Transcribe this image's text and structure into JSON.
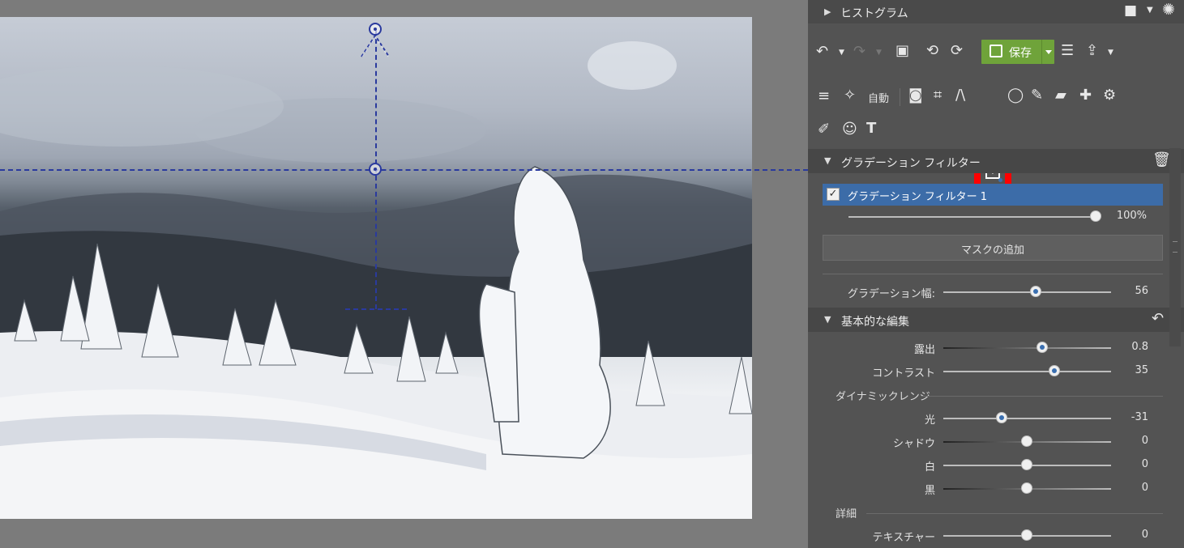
{
  "histogram": {
    "title": "ヒストグラム"
  },
  "toolbar": {
    "save_label": "保存",
    "auto_label": "自動"
  },
  "gradient_filter": {
    "section_title": "グラデーション フィルター",
    "layer_name": "グラデーション フィルター 1",
    "layer_checked": true,
    "opacity_value": "100%",
    "opacity_fraction": 1.0,
    "add_mask_label": "マスクの追加",
    "width_label": "グラデーション幅:",
    "width_value": "56",
    "width_fraction": 0.55
  },
  "basic_edit": {
    "section_title": "基本的な編集",
    "exposure": {
      "label": "露出",
      "value": "0.8",
      "fraction": 0.59
    },
    "contrast": {
      "label": "コントラスト",
      "value": "35",
      "fraction": 0.66
    },
    "dynamic_range": {
      "group_label": "ダイナミックレンジ",
      "light": {
        "label": "光",
        "value": "-31",
        "fraction": 0.35
      },
      "shadows": {
        "label": "シャドウ",
        "value": "0",
        "fraction": 0.5
      },
      "whites": {
        "label": "白",
        "value": "0",
        "fraction": 0.5
      },
      "blacks": {
        "label": "黒",
        "value": "0",
        "fraction": 0.5
      }
    },
    "detail": {
      "group_label": "詳細",
      "texture": {
        "label": "テキスチャー",
        "value": "0",
        "fraction": 0.5
      }
    }
  },
  "colors": {
    "accent_blue": "#3c6ca8",
    "save_green": "#6fa33a",
    "highlight_red": "#ff0000",
    "guide_blue": "#2a3a9e"
  }
}
